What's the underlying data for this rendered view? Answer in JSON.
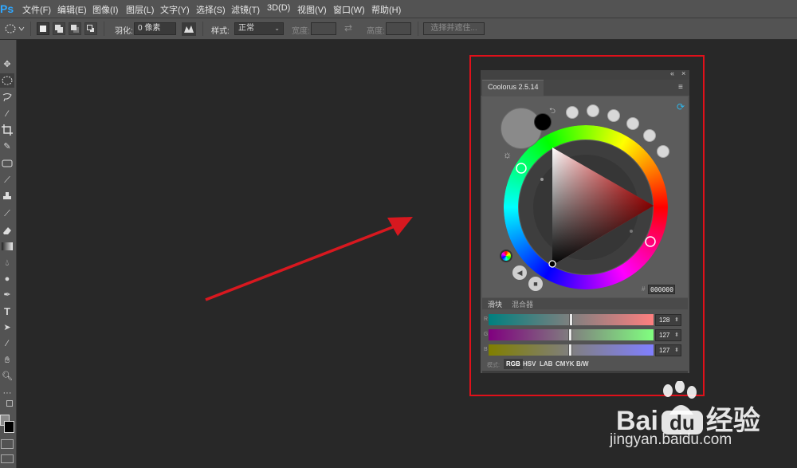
{
  "app": {
    "logo_text": "Ps",
    "menu": [
      "文件(F)",
      "编辑(E)",
      "图像(I)",
      "图层(L)",
      "文字(Y)",
      "选择(S)",
      "滤镜(T)",
      "3D(D)",
      "视图(V)",
      "窗口(W)",
      "帮助(H)"
    ]
  },
  "options_bar": {
    "feather_label": "羽化:",
    "feather_value": "0 像素",
    "style_label": "样式:",
    "style_value": "正常",
    "width_label": "宽度:",
    "height_label": "高度:",
    "select_mask_button": "选择并遮住..."
  },
  "toolbar": {
    "tools": [
      "move-tool",
      "elliptical-marquee-tool",
      "lasso-tool",
      "magic-wand-tool",
      "crop-tool",
      "eyedropper-tool",
      "healing-brush-tool",
      "brush-tool",
      "clone-stamp-tool",
      "history-brush-tool",
      "eraser-tool",
      "gradient-tool",
      "blur-tool",
      "dodge-tool",
      "pen-tool",
      "type-tool",
      "path-selection-tool",
      "line-tool",
      "hand-tool",
      "zoom-tool",
      "more-tools"
    ],
    "type_glyph": "T"
  },
  "panel": {
    "title": "Coolorus 2.5.14",
    "hex_label": "#",
    "hex_value": "000000",
    "tabs": [
      "滑块",
      "混合器"
    ],
    "channels": [
      {
        "label": "R",
        "value": "128",
        "fraction": 0.5
      },
      {
        "label": "G",
        "value": "127",
        "fraction": 0.5
      },
      {
        "label": "B",
        "value": "127",
        "fraction": 0.5
      }
    ],
    "mode_label": "模式:",
    "modes": [
      "RGB",
      "HSV",
      "LAB",
      "CMYK",
      "B/W"
    ],
    "selected_mode": "RGB",
    "foreground_color": "#000000",
    "background_color": "#8a8a8a"
  },
  "annotations": {
    "highlight_color": "#e0101a",
    "arrow_color": "#d8181f"
  },
  "watermark": {
    "brand": "Bai",
    "brand_suffix": "经验",
    "url": "jingyan.baidu.com"
  }
}
